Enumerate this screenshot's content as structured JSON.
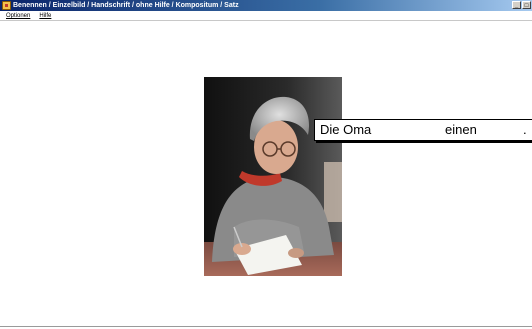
{
  "window": {
    "title": "Benennen / Einzelbild / Handschrift / ohne Hilfe / Kompositum / Satz",
    "app_icon": "exercise-app-icon",
    "controls": [
      "_",
      "□"
    ]
  },
  "menu": {
    "items": [
      {
        "label": "Optionen"
      },
      {
        "label": "Hilfe"
      }
    ]
  },
  "exercise": {
    "image_subject": "photo-elderly-woman-writing",
    "sentence": {
      "word1": "Die Oma",
      "word2": "einen",
      "word3": "."
    }
  },
  "colors": {
    "titlebar_start": "#0a246a",
    "titlebar_end": "#a6caf0",
    "background": "#ffffff"
  }
}
